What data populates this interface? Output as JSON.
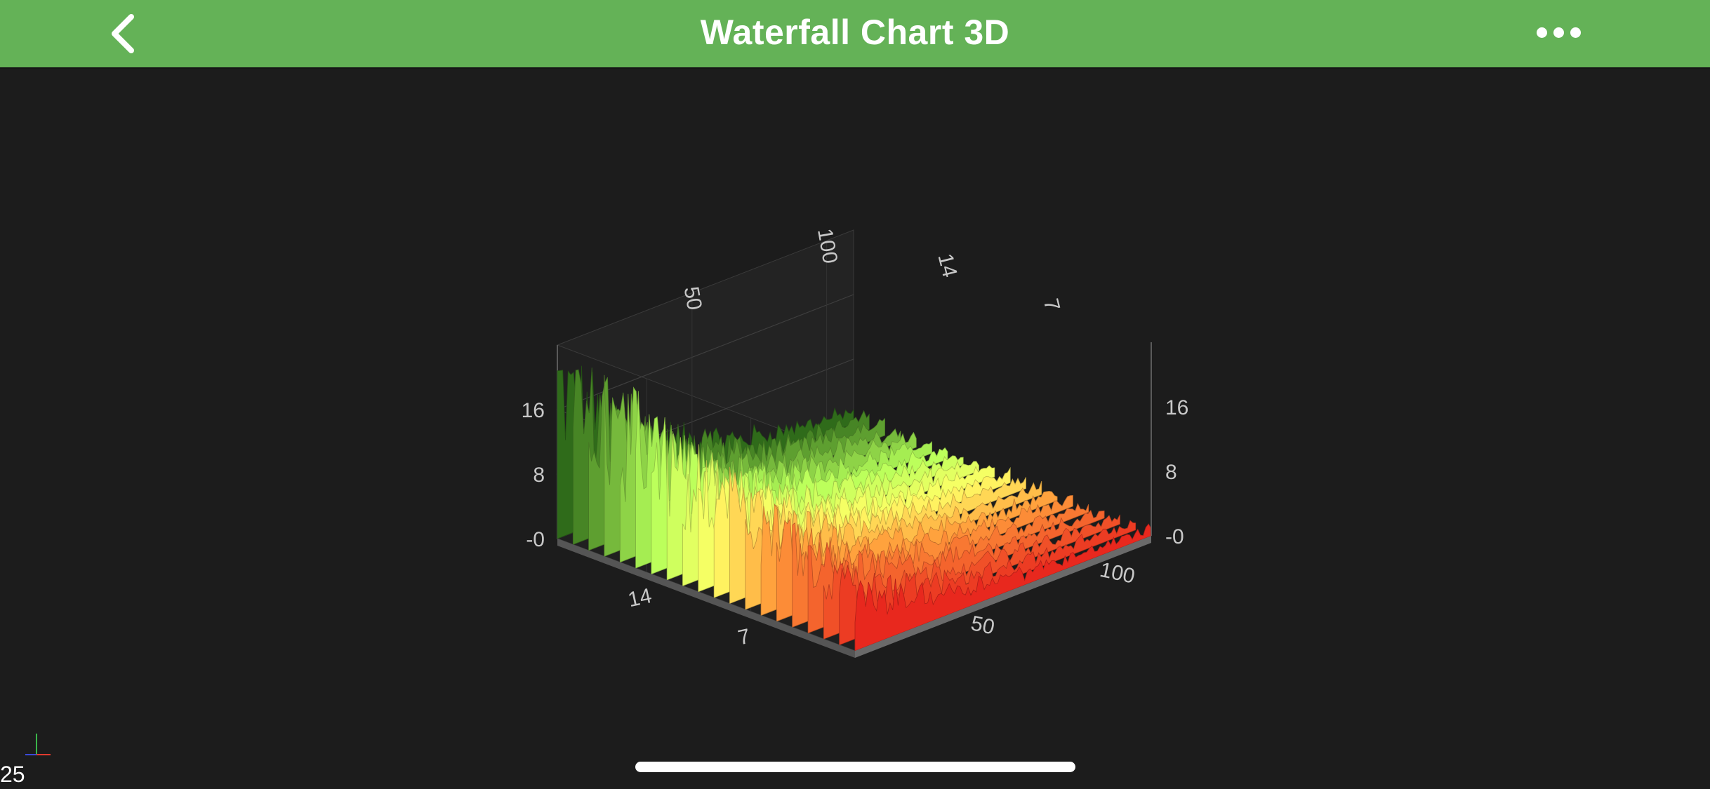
{
  "header": {
    "title": "Waterfall Chart 3D",
    "back_icon": "chevron-left-icon",
    "menu_icon": "more-horizontal-icon",
    "color": "#64b257"
  },
  "chart_data": {
    "type": "waterfall-3d",
    "title": "",
    "y_axis": {
      "ticks": [
        "-0",
        "8",
        "16"
      ],
      "range": [
        0,
        24
      ]
    },
    "z_axis": {
      "ticks": [
        "14",
        "7"
      ],
      "range": [
        20,
        0
      ]
    },
    "x_axis": {
      "ticks": [
        "50",
        "100"
      ],
      "range": [
        0,
        110
      ]
    },
    "slice_count": 20,
    "samples_per_slice": 110,
    "colors": {
      "back_slices": "#2f6b1a",
      "middle_slices": "#b6ff5a",
      "peak_slices": "#ffff66",
      "mid_front_slices": "#ff9a3a",
      "front_slices": "#e8281e",
      "floor": "#555555",
      "axis_label": "#c8c8c8",
      "background": "#1c1c1c"
    },
    "grid": true
  },
  "status": {
    "fps": "25"
  }
}
